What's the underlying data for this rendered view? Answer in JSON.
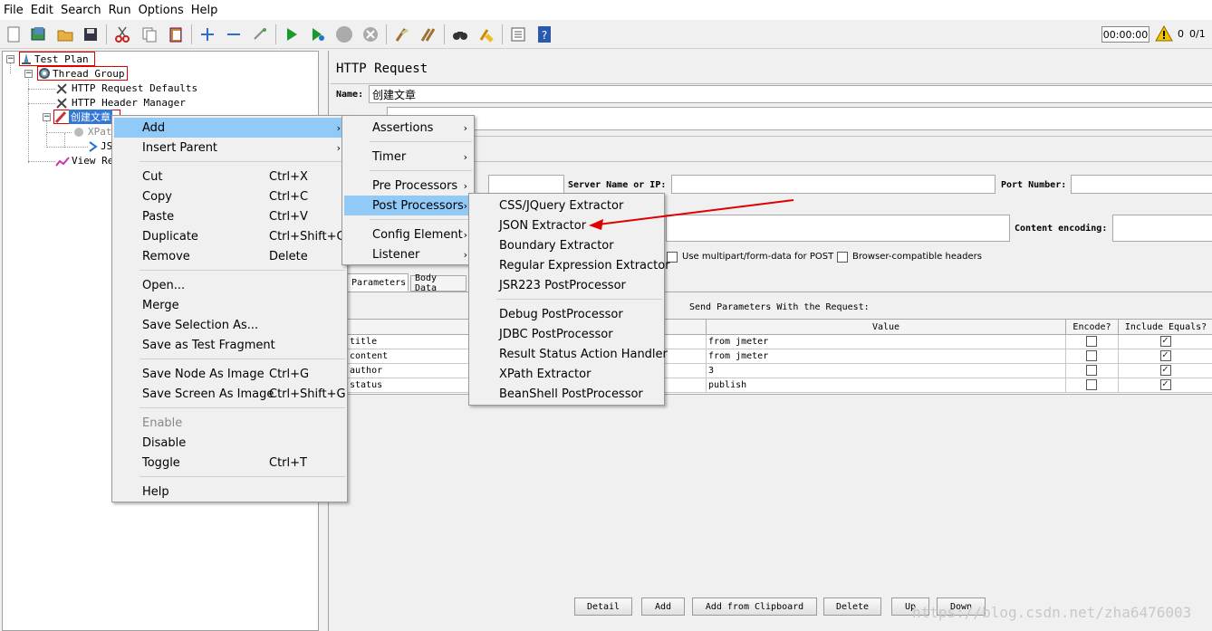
{
  "menubar": [
    "File",
    "Edit",
    "Search",
    "Run",
    "Options",
    "Help"
  ],
  "toolbar": {
    "icons": [
      "new-icon",
      "templates-icon",
      "open-icon",
      "save-icon",
      "cut-icon",
      "copy-icon",
      "paste-icon",
      "expand-icon",
      "collapse-icon",
      "toggle-icon",
      "start-icon",
      "start-no-pause-icon",
      "stop-icon",
      "shutdown-icon",
      "clear-icon",
      "clear-all-icon",
      "search-icon",
      "reset-search-icon",
      "function-helper-icon",
      "help-icon"
    ],
    "timer": "00:00:00",
    "error_count": "0",
    "thread_count": "0/1"
  },
  "tree": {
    "test_plan": "Test Plan",
    "thread_group": "Thread Group",
    "http_defaults": "HTTP Request Defaults",
    "header_manager": "HTTP Header Manager",
    "sampler": "创建文章",
    "xpath": "XPat",
    "json": "JSON",
    "view": "View Re"
  },
  "panel": {
    "title": "HTTP Request",
    "name_label": "Name:",
    "name_value": "创建文章",
    "server_label": "Server Name or IP:",
    "port_label": "Port Number:",
    "encoding_label": "Content encoding:",
    "multipart_label": "Use multipart/form-data for POST",
    "browser_headers_label": "Browser-compatible headers",
    "tabs": [
      "Parameters",
      "Body Data"
    ],
    "send_params_label": "Send Parameters With the Request:",
    "columns": [
      "Value",
      "Encode?",
      "Include Equals?"
    ],
    "rows": [
      {
        "name": "title",
        "value": "from jmeter",
        "encode": false,
        "include": true
      },
      {
        "name": "content",
        "value": "from jmeter",
        "encode": false,
        "include": true
      },
      {
        "name": "author",
        "value": "3",
        "encode": false,
        "include": true
      },
      {
        "name": "status",
        "value": "publish",
        "encode": false,
        "include": true
      }
    ],
    "buttons": [
      "Detail",
      "Add",
      "Add from Clipboard",
      "Delete",
      "Up",
      "Down"
    ]
  },
  "watermark": "https://blog.csdn.net/zha6476003",
  "context_menu": [
    {
      "label": "Add",
      "shortcut": "",
      "submenu": true,
      "highlight": true
    },
    {
      "label": "Insert Parent",
      "shortcut": "",
      "submenu": true
    },
    {
      "sep": true
    },
    {
      "label": "Cut",
      "shortcut": "Ctrl+X"
    },
    {
      "label": "Copy",
      "shortcut": "Ctrl+C"
    },
    {
      "label": "Paste",
      "shortcut": "Ctrl+V"
    },
    {
      "label": "Duplicate",
      "shortcut": "Ctrl+Shift+C"
    },
    {
      "label": "Remove",
      "shortcut": "Delete"
    },
    {
      "sep": true
    },
    {
      "label": "Open...",
      "shortcut": ""
    },
    {
      "label": "Merge",
      "shortcut": ""
    },
    {
      "label": "Save Selection As...",
      "shortcut": ""
    },
    {
      "label": "Save as Test Fragment",
      "shortcut": ""
    },
    {
      "sep": true
    },
    {
      "label": "Save Node As Image",
      "shortcut": "Ctrl+G"
    },
    {
      "label": "Save Screen As Image",
      "shortcut": "Ctrl+Shift+G"
    },
    {
      "sep": true
    },
    {
      "label": "Enable",
      "shortcut": "",
      "disabled": true
    },
    {
      "label": "Disable",
      "shortcut": ""
    },
    {
      "label": "Toggle",
      "shortcut": "Ctrl+T"
    },
    {
      "sep": true
    },
    {
      "label": "Help",
      "shortcut": ""
    }
  ],
  "add_menu": [
    {
      "label": "Assertions",
      "submenu": true
    },
    {
      "sep": true
    },
    {
      "label": "Timer",
      "submenu": true
    },
    {
      "sep": true
    },
    {
      "label": "Pre Processors",
      "submenu": true
    },
    {
      "label": "Post Processors",
      "submenu": true,
      "highlight": true
    },
    {
      "sep": true
    },
    {
      "label": "Config Element",
      "submenu": true
    },
    {
      "label": "Listener",
      "submenu": true
    }
  ],
  "post_menu": [
    {
      "label": "CSS/JQuery Extractor"
    },
    {
      "label": "JSON Extractor"
    },
    {
      "label": "Boundary Extractor"
    },
    {
      "label": "Regular Expression Extractor"
    },
    {
      "label": "JSR223 PostProcessor"
    },
    {
      "sep": true
    },
    {
      "label": "Debug PostProcessor"
    },
    {
      "label": "JDBC PostProcessor"
    },
    {
      "label": "Result Status Action Handler"
    },
    {
      "label": "XPath Extractor"
    },
    {
      "label": "BeanShell PostProcessor"
    }
  ],
  "colors": {
    "highlight": "#91c9f7",
    "selection": "#3478d6",
    "annotation": "#e00000"
  }
}
